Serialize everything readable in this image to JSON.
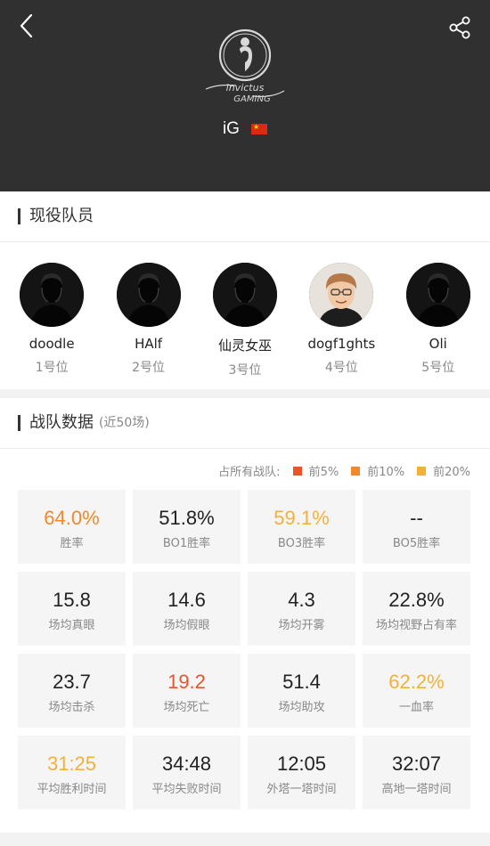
{
  "header": {
    "team_name": "iG",
    "logo_text": "invictus gaming"
  },
  "roster": {
    "title": "现役队员",
    "players": [
      {
        "name": "doodle",
        "position": "1号位"
      },
      {
        "name": "HAlf",
        "position": "2号位"
      },
      {
        "name": "仙灵女巫",
        "position": "3号位"
      },
      {
        "name": "dogf1ghts",
        "position": "4号位"
      },
      {
        "name": "Oli",
        "position": "5号位"
      }
    ]
  },
  "stats": {
    "title": "战队数据",
    "subtitle": "(近50场)",
    "legend": {
      "prefix": "占所有战队:",
      "items": [
        {
          "label": "前5%",
          "color": "#e8552a"
        },
        {
          "label": "前10%",
          "color": "#f0892e"
        },
        {
          "label": "前20%",
          "color": "#f4b13a"
        }
      ]
    },
    "cells": [
      {
        "value": "64.0%",
        "label": "胜率",
        "color": "#f0892e"
      },
      {
        "value": "51.8%",
        "label": "BO1胜率",
        "color": "#222222"
      },
      {
        "value": "59.1%",
        "label": "BO3胜率",
        "color": "#f4b13a"
      },
      {
        "value": "--",
        "label": "BO5胜率",
        "color": "#222222"
      },
      {
        "value": "15.8",
        "label": "场均真眼",
        "color": "#222222"
      },
      {
        "value": "14.6",
        "label": "场均假眼",
        "color": "#222222"
      },
      {
        "value": "4.3",
        "label": "场均开雾",
        "color": "#222222"
      },
      {
        "value": "22.8%",
        "label": "场均视野占有率",
        "color": "#222222"
      },
      {
        "value": "23.7",
        "label": "场均击杀",
        "color": "#222222"
      },
      {
        "value": "19.2",
        "label": "场均死亡",
        "color": "#e8552a"
      },
      {
        "value": "51.4",
        "label": "场均助攻",
        "color": "#222222"
      },
      {
        "value": "62.2%",
        "label": "一血率",
        "color": "#f4b13a"
      },
      {
        "value": "31:25",
        "label": "平均胜利时间",
        "color": "#f4b13a"
      },
      {
        "value": "34:48",
        "label": "平均失败时间",
        "color": "#222222"
      },
      {
        "value": "12:05",
        "label": "外塔一塔时间",
        "color": "#222222"
      },
      {
        "value": "32:07",
        "label": "高地一塔时间",
        "color": "#222222"
      }
    ]
  }
}
